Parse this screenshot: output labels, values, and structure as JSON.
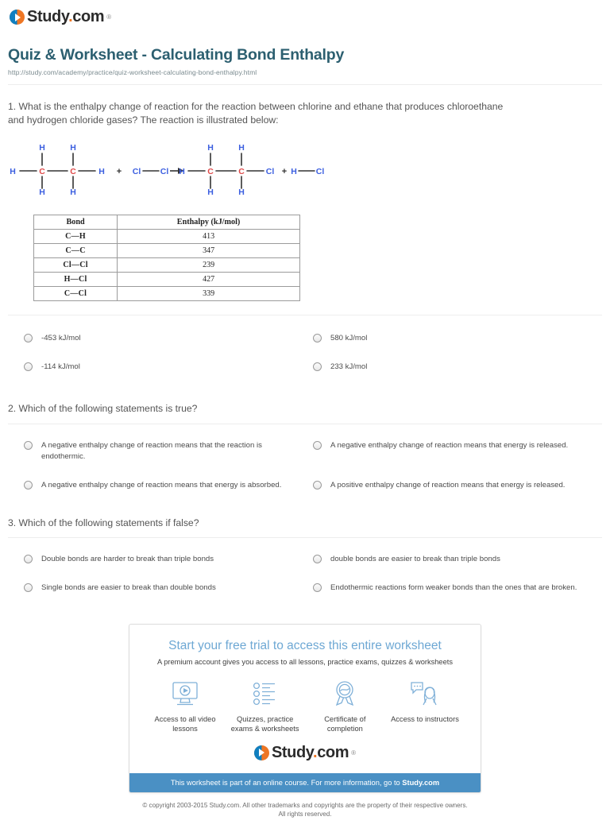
{
  "brand": {
    "name_main": "Study",
    "name_dot": ".",
    "name_tld": "com",
    "trademark": "®"
  },
  "header": {
    "title": "Quiz & Worksheet - Calculating Bond Enthalpy",
    "url": "http://study.com/academy/practice/quiz-worksheet-calculating-bond-enthalpy.html"
  },
  "questions": [
    {
      "text": "1. What is the enthalpy change of reaction for the reaction between chlorine and ethane that produces chloroethane and hydrogen chloride gases? The reaction is illustrated below:",
      "options": [
        "-453 kJ/mol",
        "580 kJ/mol",
        "-114 kJ/mol",
        "233 kJ/mol"
      ]
    },
    {
      "text": "2. Which of the following statements is true?",
      "options": [
        "A negative enthalpy change of reaction means that the reaction is endothermic.",
        "A negative enthalpy change of reaction means that energy is released.",
        "A negative enthalpy change of reaction means that energy is absorbed.",
        "A positive enthalpy change of reaction means that energy is released."
      ]
    },
    {
      "text": "3. Which of the following statements if false?",
      "options": [
        "Double bonds are harder to break than triple bonds",
        "double bonds are easier to break than triple bonds",
        "Single bonds are easier to break than double bonds",
        "Endothermic reactions form weaker bonds than the ones that are broken."
      ]
    }
  ],
  "reaction": {
    "reactant1_label": "ethane",
    "plus1": "+",
    "plus2": "+",
    "atoms": {
      "hydrogen": "H",
      "carbon": "C",
      "chlorine": "Cl"
    },
    "colors": {
      "hydrogen": "#3c5fe0",
      "carbon": "#e04a4a",
      "chlorine": "#3c5fe0",
      "bond": "#333333"
    }
  },
  "bond_table": {
    "headers": [
      "Bond",
      "Enthalpy (kJ/mol)"
    ],
    "rows": [
      {
        "bond": "C—H",
        "enthalpy": "413"
      },
      {
        "bond": "C—C",
        "enthalpy": "347"
      },
      {
        "bond": "Cl—Cl",
        "enthalpy": "239"
      },
      {
        "bond": "H—Cl",
        "enthalpy": "427"
      },
      {
        "bond": "C—Cl",
        "enthalpy": "339"
      }
    ]
  },
  "promo": {
    "title": "Start your free trial to access this entire worksheet",
    "subtitle": "A premium account gives you access to all lessons, practice exams, quizzes & worksheets",
    "features": [
      {
        "icon": "monitor-play-icon",
        "label": "Access to all video lessons"
      },
      {
        "icon": "checklist-icon",
        "label": "Quizzes, practice exams & worksheets"
      },
      {
        "icon": "award-ribbon-icon",
        "label": "Certificate of completion"
      },
      {
        "icon": "instructor-chat-icon",
        "label": "Access to instructors"
      }
    ],
    "bar_text": "This worksheet is part of an online course. For more information, go to ",
    "bar_link": "Study.com",
    "accent_color": "#4a90c4"
  },
  "footer": {
    "line1": "© copyright 2003-2015 Study.com. All other trademarks and copyrights are the property of their respective owners.",
    "line2": "All rights reserved."
  }
}
